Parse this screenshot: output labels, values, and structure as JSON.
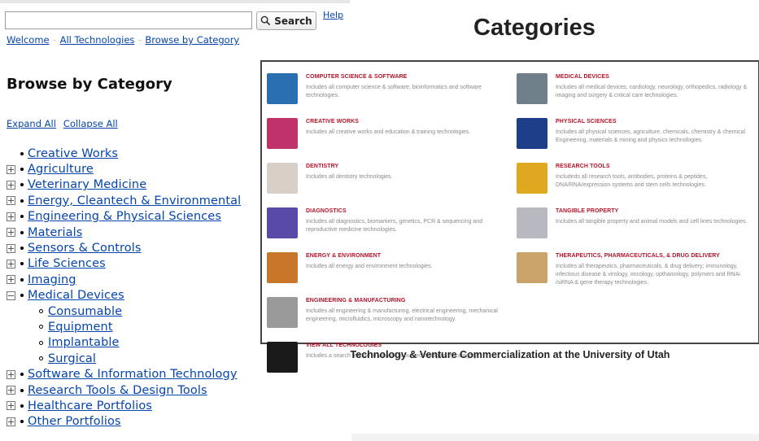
{
  "search": {
    "value": "",
    "button_label": "Search",
    "help_label": "Help"
  },
  "breadcrumb": [
    "Welcome",
    "All Technologies",
    "Browse by Category"
  ],
  "page_title": "Browse by Category",
  "controls": {
    "expand": "Expand All",
    "collapse": "Collapse All"
  },
  "tree": [
    {
      "label": "Creative Works",
      "toggle": "none"
    },
    {
      "label": "Agriculture",
      "toggle": "plus"
    },
    {
      "label": "Veterinary Medicine",
      "toggle": "plus"
    },
    {
      "label": "Energy, Cleantech & Environmental",
      "toggle": "plus"
    },
    {
      "label": "Engineering & Physical Sciences",
      "toggle": "plus"
    },
    {
      "label": "Materials",
      "toggle": "plus"
    },
    {
      "label": "Sensors & Controls",
      "toggle": "plus"
    },
    {
      "label": "Life Sciences",
      "toggle": "plus"
    },
    {
      "label": "Imaging",
      "toggle": "plus"
    },
    {
      "label": "Medical Devices",
      "toggle": "minus"
    },
    {
      "label": "Consumable",
      "toggle": "child"
    },
    {
      "label": "Equipment",
      "toggle": "child"
    },
    {
      "label": "Implantable",
      "toggle": "child"
    },
    {
      "label": "Surgical",
      "toggle": "child"
    },
    {
      "label": "Software & Information Technology",
      "toggle": "plus"
    },
    {
      "label": "Research Tools & Design Tools",
      "toggle": "plus"
    },
    {
      "label": "Healthcare Portfolios",
      "toggle": "plus"
    },
    {
      "label": "Other Portfolios",
      "toggle": "plus"
    }
  ],
  "categories_heading": "Categories",
  "panel": {
    "left": [
      {
        "title": "COMPUTER SCIENCE & SOFTWARE",
        "desc": "Includes all computer science & software, bioinformatics and software technologies.",
        "thumb_color": "#2a6fb0"
      },
      {
        "title": "CREATIVE WORKS",
        "desc": "Includes all creative works and education & training technologies.",
        "thumb_color": "#c0336a"
      },
      {
        "title": "DENTISTRY",
        "desc": "Includes all dentistry technologies.",
        "thumb_color": "#d8cfc8"
      },
      {
        "title": "DIAGNOSTICS",
        "desc": "Includes all diagnostics, biomarkers, genetics, PCR & sequencing and reproductive medicine technologies.",
        "thumb_color": "#5a4aa8"
      },
      {
        "title": "ENERGY & ENVIRONMENT",
        "desc": "Includes all energy and environment technologies.",
        "thumb_color": "#c8772a"
      },
      {
        "title": "ENGINEERING & MANUFACTURING",
        "desc": "Includes all engineering & manufacturing, electrical engineering, mechanical engineering, microfluidics, microscopy and nanotechnology.",
        "thumb_color": "#9a9a9a"
      },
      {
        "title": "VIEW ALL TECHNOLOGIES",
        "desc": "Includes a search feature to view all of our technologies by category.",
        "thumb_color": "#1a1a1a"
      }
    ],
    "right": [
      {
        "title": "MEDICAL DEVICES",
        "desc": "Includes all medical devices, cardiology, neurology, orthopedics, radiology & imaging and surgery & critical care technologies.",
        "thumb_color": "#6f7f8a"
      },
      {
        "title": "PHYSICAL SCIENCES",
        "desc": "Includes all physical sciences, agriculture, chemicals, chemistry & chemical Engineering, materials & mining and physics technologies.",
        "thumb_color": "#1d3f8a"
      },
      {
        "title": "RESEARCH TOOLS",
        "desc": "Includeds all research tools, antibodies, proteins & peptides, DNA/RNA/expression systems and stem cells technologies.",
        "thumb_color": "#e0a81e"
      },
      {
        "title": "TANGIBLE PROPERTY",
        "desc": "Includes all tangible property and animal models and cell lines technologies.",
        "thumb_color": "#b8b8c0"
      },
      {
        "title": "THERAPEUTICS, PHARMACEUTICALS, & DRUG DELIVERY",
        "desc": "Includes all therapeutics, pharmaceuticals, & drug delivery; immunology, infectious disease & virology, oncology, opthamology, polymers and RNAi /siRNA & gene therapy technologies.",
        "thumb_color": "#c9a36a"
      }
    ]
  },
  "caption": "Technology & Venture Commercialization at the University of Utah"
}
